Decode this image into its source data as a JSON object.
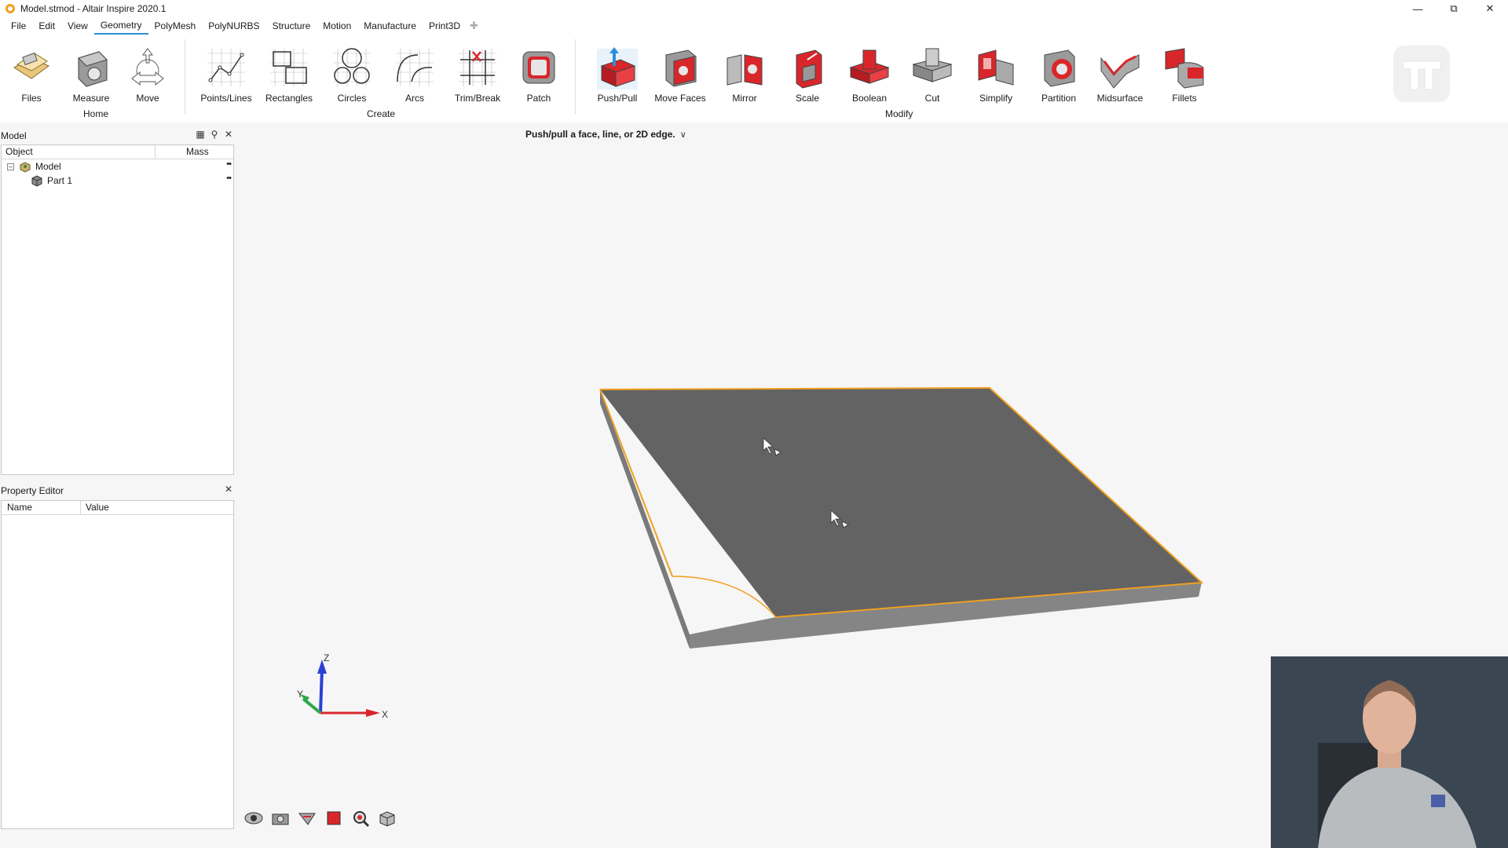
{
  "window": {
    "title": "Model.stmod - Altair Inspire 2020.1",
    "minimize_icon": "minimize-icon",
    "restore_icon": "restore-icon",
    "close_icon": "close-icon"
  },
  "menu": {
    "items": [
      "File",
      "Edit",
      "View",
      "Geometry",
      "PolyMesh",
      "PolyNURBS",
      "Structure",
      "Motion",
      "Manufacture",
      "Print3D"
    ],
    "active": "Geometry"
  },
  "ribbon": {
    "tools": {
      "files": "Files",
      "measure": "Measure",
      "move": "Move",
      "points_lines": "Points/Lines",
      "rectangles": "Rectangles",
      "circles": "Circles",
      "arcs": "Arcs",
      "trim_break": "Trim/Break",
      "patch": "Patch",
      "push_pull": "Push/Pull",
      "move_faces": "Move Faces",
      "mirror": "Mirror",
      "scale": "Scale",
      "boolean": "Boolean",
      "cut": "Cut",
      "simplify": "Simplify",
      "partition": "Partition",
      "midsurface": "Midsurface",
      "fillets": "Fillets"
    },
    "groups": {
      "home": "Home",
      "create": "Create",
      "modify": "Modify"
    },
    "accent_color": "#d9262b"
  },
  "model_panel": {
    "title": "Model",
    "columns": {
      "object": "Object",
      "mass": "Mass"
    },
    "rows": [
      {
        "label": "Model",
        "more": "••"
      },
      {
        "label": "Part 1",
        "more": "••"
      }
    ]
  },
  "property_editor": {
    "title": "Property Editor",
    "columns": {
      "name": "Name",
      "value": "Value"
    }
  },
  "viewport": {
    "hint": "Push/pull a face, line, or 2D edge.",
    "triad": {
      "z": "Z",
      "y": "Y",
      "x": "X"
    },
    "edge_highlight_color": "#f0a020",
    "face_color": "#626262"
  }
}
